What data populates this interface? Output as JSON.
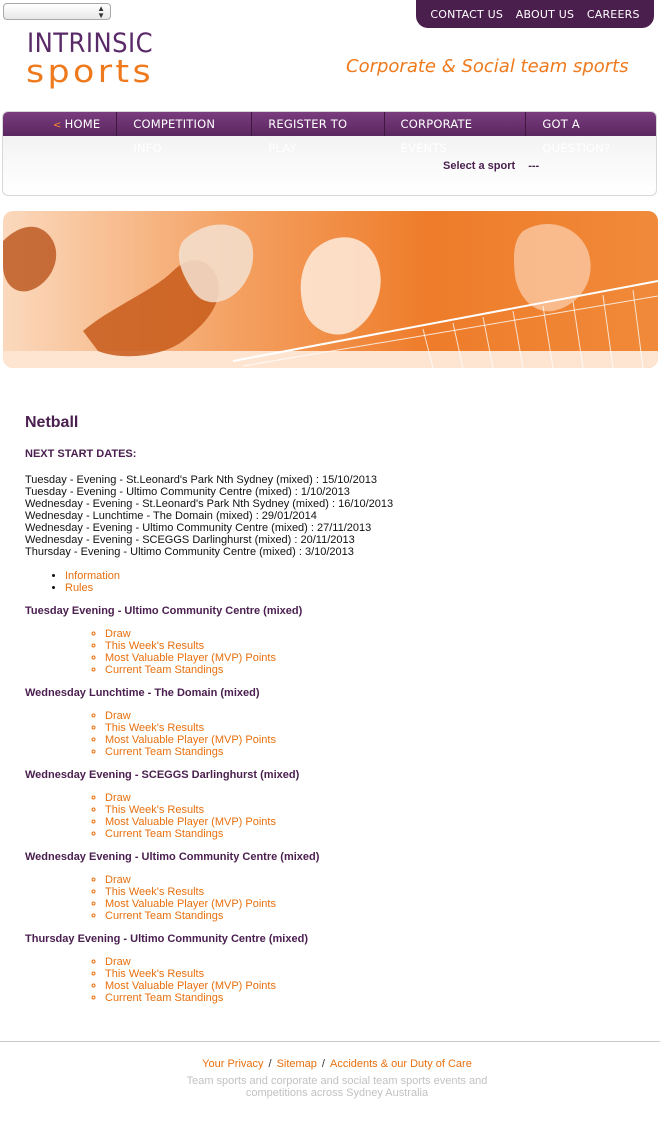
{
  "header": {
    "top_links": [
      "CONTACT US",
      "ABOUT US",
      "CAREERS"
    ],
    "logo_line1": "INTRINSIC",
    "logo_line2": "sports",
    "tagline": "Corporate & Social team sports"
  },
  "nav": {
    "home_chevron": "<",
    "items": [
      "HOME",
      "COMPETITION INFO",
      "REGISTER TO PLAY",
      "CORPORATE EVENTS",
      "GOT A QUESTION?"
    ],
    "select_label": "Select a sport",
    "select_value": "---"
  },
  "main": {
    "title": "Netball",
    "next_start_heading": "NEXT START DATES:",
    "dates": [
      "Tuesday - Evening - St.Leonard's Park Nth Sydney (mixed) : 15/10/2013",
      "Tuesday - Evening - Ultimo Community Centre (mixed) : 1/10/2013",
      "Wednesday - Evening - St.Leonard's Park Nth Sydney (mixed) : 16/10/2013",
      "Wednesday - Lunchtime - The Domain (mixed) : 29/01/2014",
      "Wednesday - Evening - Ultimo Community Centre (mixed) : 27/11/2013",
      "Wednesday - Evening - SCEGGS Darlinghurst (mixed) : 20/11/2013",
      "Thursday - Evening - Ultimo Community Centre (mixed) : 3/10/2013"
    ],
    "info_links": [
      "Information",
      "Rules"
    ],
    "groups": [
      {
        "title": "Tuesday Evening - Ultimo Community Centre (mixed)",
        "links": [
          "Draw",
          "This Week's Results",
          "Most Valuable Player (MVP) Points",
          "Current Team Standings"
        ]
      },
      {
        "title": "Wednesday Lunchtime - The Domain (mixed)",
        "links": [
          "Draw",
          "This Week's Results",
          "Most Valuable Player (MVP) Points",
          "Current Team Standings"
        ]
      },
      {
        "title": "Wednesday Evening - SCEGGS Darlinghurst (mixed)",
        "links": [
          "Draw",
          "This Week's Results",
          "Most Valuable Player (MVP) Points",
          "Current Team Standings"
        ]
      },
      {
        "title": "Wednesday Evening - Ultimo Community Centre (mixed)",
        "links": [
          "Draw",
          "This Week's Results",
          "Most Valuable Player (MVP) Points",
          "Current Team Standings"
        ]
      },
      {
        "title": "Thursday Evening - Ultimo Community Centre (mixed)",
        "links": [
          "Draw",
          "This Week's Results",
          "Most Valuable Player (MVP) Points",
          "Current Team Standings"
        ]
      }
    ]
  },
  "footer": {
    "links": [
      "Your Privacy",
      "Sitemap",
      "Accidents & our Duty of Care"
    ],
    "separator": "/",
    "text": "Team sports and corporate and social team sports events and competitions across Sydney Australia"
  },
  "colors": {
    "purple": "#4b2050",
    "orange": "#e8700f",
    "nav_purple": "#6b3270"
  }
}
